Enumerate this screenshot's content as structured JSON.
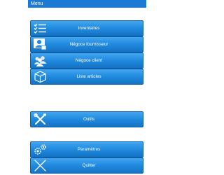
{
  "header": {
    "title": "Menu"
  },
  "menu": {
    "inventaires": "Inventaires",
    "negoce_fournisseur": "Négoce fournisseur",
    "negoce_client": "Négoce client",
    "liste_articles": "Liste articles",
    "outils": "Outils",
    "parametres": "Paramètres",
    "quitter": "Quitter"
  },
  "colors": {
    "title_bar": "#1a7bd6",
    "button_top": "#41a5f0",
    "button_bottom": "#1673c4",
    "text": "#ffffff"
  }
}
